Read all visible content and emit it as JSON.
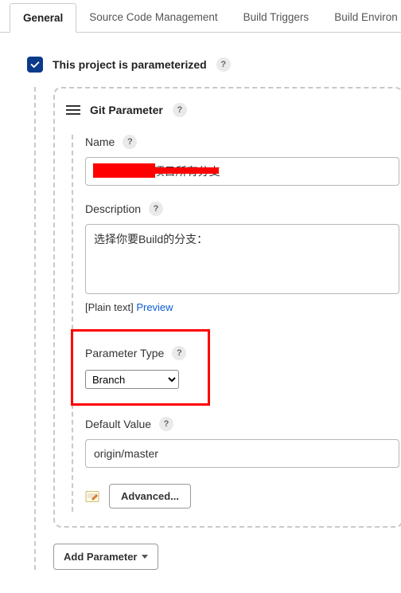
{
  "tabs": {
    "general": "General",
    "scm": "Source Code Management",
    "triggers": "Build Triggers",
    "env": "Build Environ"
  },
  "parameterized": {
    "label": "This project is parameterized"
  },
  "gitparam": {
    "title": "Git Parameter",
    "name": {
      "label": "Name",
      "value": "            商城项目所有分支"
    },
    "description": {
      "label": "Description",
      "value": "选择你要Build的分支："
    },
    "plain_text": "[Plain text] ",
    "preview": "Preview",
    "param_type": {
      "label": "Parameter Type",
      "value": "Branch"
    },
    "default_value": {
      "label": "Default Value",
      "value": "origin/master"
    },
    "advanced": "Advanced..."
  },
  "add_parameter": "Add Parameter"
}
